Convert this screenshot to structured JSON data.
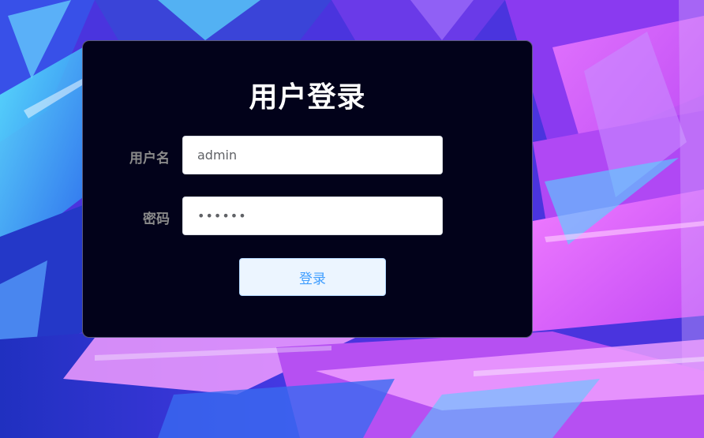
{
  "login": {
    "title": "用户登录",
    "username_label": "用户名",
    "username_value": "admin",
    "password_label": "密码",
    "password_value": "••••••",
    "submit_label": "登录"
  },
  "colors": {
    "card_background": "#02021a",
    "button_background": "#ecf5ff",
    "button_text": "#409eff",
    "label_text": "#8a8a8a"
  }
}
